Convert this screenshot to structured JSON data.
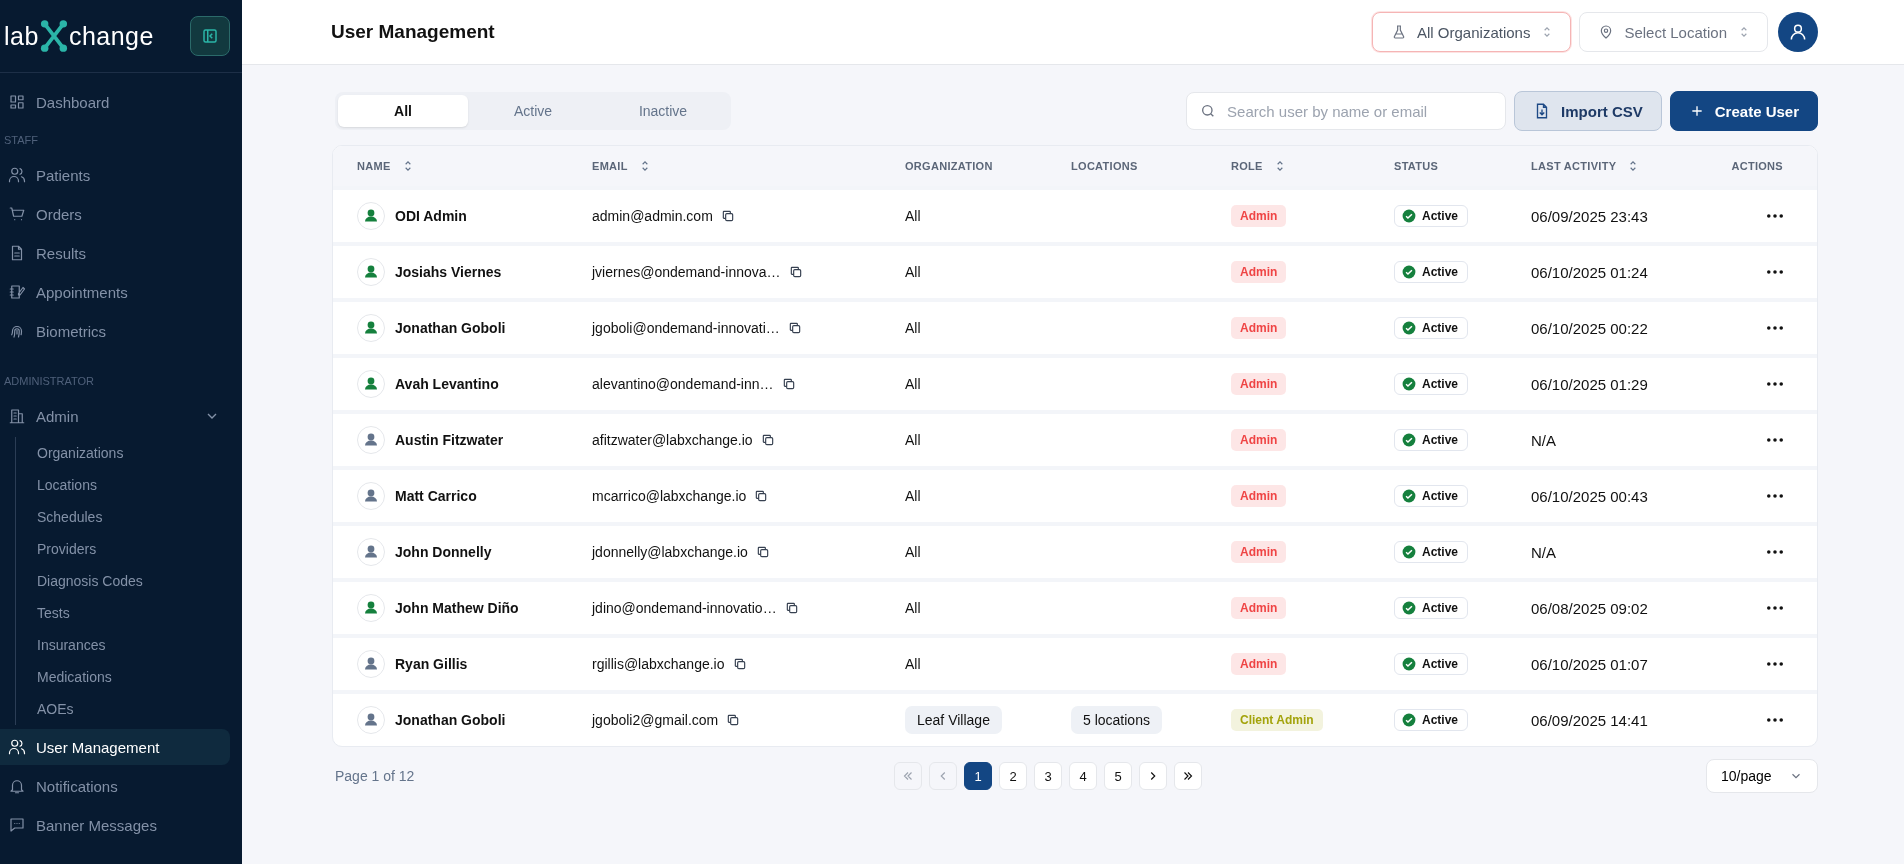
{
  "logo": {
    "left": "lab",
    "right": "change"
  },
  "sidebar": {
    "sections": [
      {
        "items": [
          {
            "label": "Dashboard",
            "selected": false
          }
        ]
      },
      {
        "heading": "STAFF",
        "items": [
          {
            "label": "Patients",
            "selected": false
          },
          {
            "label": "Orders",
            "selected": false
          },
          {
            "label": "Results",
            "selected": false
          },
          {
            "label": "Appointments",
            "selected": false
          },
          {
            "label": "Biometrics",
            "selected": false
          }
        ]
      },
      {
        "heading": "ADMINISTRATOR",
        "items": [
          {
            "label": "Admin",
            "selected": false,
            "expanded": true,
            "children": [
              {
                "label": "Organizations",
                "selected": false
              },
              {
                "label": "Locations",
                "selected": false
              },
              {
                "label": "Schedules",
                "selected": false
              },
              {
                "label": "Providers",
                "selected": false
              },
              {
                "label": "Diagnosis Codes",
                "selected": false
              },
              {
                "label": "Tests",
                "selected": false
              },
              {
                "label": "Insurances",
                "selected": false
              },
              {
                "label": "Medications",
                "selected": false
              },
              {
                "label": "AOEs",
                "selected": false
              }
            ]
          }
        ]
      },
      {
        "items": [
          {
            "label": "User Management",
            "selected": true
          },
          {
            "label": "Notifications",
            "selected": false
          },
          {
            "label": "Banner Messages",
            "selected": false
          }
        ]
      }
    ]
  },
  "header": {
    "title": "User Management",
    "organization_select": {
      "value": "All Organizations"
    },
    "location_select": {
      "placeholder": "Select Location"
    }
  },
  "tabs": [
    {
      "label": "All",
      "selected": true
    },
    {
      "label": "Active",
      "selected": false
    },
    {
      "label": "Inactive",
      "selected": false
    }
  ],
  "search": {
    "placeholder": "Search user by name or email"
  },
  "buttons": {
    "import": "Import CSV",
    "create": "Create User"
  },
  "table": {
    "columns": [
      {
        "label": "NAME",
        "sortable": true
      },
      {
        "label": "EMAIL",
        "sortable": true
      },
      {
        "label": "ORGANIZATION",
        "sortable": false
      },
      {
        "label": "LOCATIONS",
        "sortable": false
      },
      {
        "label": "ROLE",
        "sortable": true
      },
      {
        "label": "STATUS",
        "sortable": false
      },
      {
        "label": "LAST ACTIVITY",
        "sortable": true
      },
      {
        "label": "ACTIONS",
        "sortable": false
      }
    ],
    "rows": [
      {
        "name": "ODI Admin",
        "avatar": {
          "color": "#15803d"
        },
        "email": "admin@admin.com",
        "organization": {
          "label": "All",
          "kind": "text"
        },
        "role": {
          "label": "Admin",
          "color": "#ef4444"
        },
        "status": "Active",
        "last_activity": "06/09/2025 23:43"
      },
      {
        "name": "Josiahs Viernes",
        "avatar": {
          "color": "#15803d"
        },
        "email": "jviernes@ondemand-innova…",
        "organization": {
          "label": "All",
          "kind": "text"
        },
        "role": {
          "label": "Admin",
          "color": "#ef4444"
        },
        "status": "Active",
        "last_activity": "06/10/2025 01:24"
      },
      {
        "name": "Jonathan Goboli",
        "avatar": {
          "color": "#15803d"
        },
        "email": "jgoboli@ondemand-innovati…",
        "organization": {
          "label": "All",
          "kind": "text"
        },
        "role": {
          "label": "Admin",
          "color": "#ef4444"
        },
        "status": "Active",
        "last_activity": "06/10/2025 00:22"
      },
      {
        "name": "Avah Levantino",
        "avatar": {
          "color": "#15803d"
        },
        "email": "alevantino@ondemand-inn…",
        "organization": {
          "label": "All",
          "kind": "text"
        },
        "role": {
          "label": "Admin",
          "color": "#ef4444"
        },
        "status": "Active",
        "last_activity": "06/10/2025 01:29"
      },
      {
        "name": "Austin Fitzwater",
        "avatar": {
          "color": "#64748b"
        },
        "email": "afitzwater@labxchange.io",
        "organization": {
          "label": "All",
          "kind": "text"
        },
        "role": {
          "label": "Admin",
          "color": "#ef4444"
        },
        "status": "Active",
        "last_activity": "N/A"
      },
      {
        "name": "Matt Carrico",
        "avatar": {
          "color": "#64748b"
        },
        "email": "mcarrico@labxchange.io",
        "organization": {
          "label": "All",
          "kind": "text"
        },
        "role": {
          "label": "Admin",
          "color": "#ef4444"
        },
        "status": "Active",
        "last_activity": "06/10/2025 00:43"
      },
      {
        "name": "John Donnelly",
        "avatar": {
          "color": "#64748b"
        },
        "email": "jdonnelly@labxchange.io",
        "organization": {
          "label": "All",
          "kind": "text"
        },
        "role": {
          "label": "Admin",
          "color": "#ef4444"
        },
        "status": "Active",
        "last_activity": "N/A"
      },
      {
        "name": "John Mathew Diño",
        "avatar": {
          "color": "#15803d"
        },
        "email": "jdino@ondemand-innovatio…",
        "organization": {
          "label": "All",
          "kind": "text"
        },
        "role": {
          "label": "Admin",
          "color": "#ef4444"
        },
        "status": "Active",
        "last_activity": "06/08/2025 09:02"
      },
      {
        "name": "Ryan Gillis",
        "avatar": {
          "color": "#64748b"
        },
        "email": "rgillis@labxchange.io",
        "organization": {
          "label": "All",
          "kind": "text"
        },
        "role": {
          "label": "Admin",
          "color": "#ef4444"
        },
        "status": "Active",
        "last_activity": "06/10/2025 01:07"
      },
      {
        "name": "Jonathan Goboli",
        "avatar": {
          "color": "#64748b"
        },
        "email": "jgoboli2@gmail.com",
        "organization": {
          "label": "Leaf Village",
          "kind": "chip"
        },
        "locations": "5 locations",
        "role": {
          "label": "Client Admin",
          "color": "#a3a30b"
        },
        "status": "Active",
        "last_activity": "06/09/2025 14:41"
      }
    ]
  },
  "pagination": {
    "summary": "Page 1 of 12",
    "first_disabled": true,
    "prev_disabled": true,
    "pages": [
      {
        "label": "1",
        "selected": true
      },
      {
        "label": "2",
        "selected": false
      },
      {
        "label": "3",
        "selected": false
      },
      {
        "label": "4",
        "selected": false
      },
      {
        "label": "5",
        "selected": false
      }
    ],
    "page_size": "10/page"
  }
}
